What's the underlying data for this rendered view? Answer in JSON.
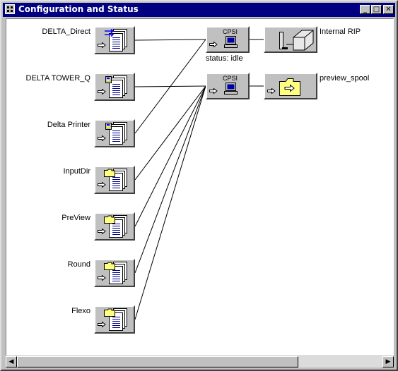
{
  "window": {
    "title": "Configuration and Status",
    "controls": {
      "minimize": "_",
      "maximize": "□",
      "close": "✕"
    }
  },
  "queues": [
    {
      "label": "DELTA_Direct",
      "icon": "direct-queue-icon"
    },
    {
      "label": "DELTA TOWER_Q",
      "icon": "printer-queue-icon"
    },
    {
      "label": "Delta Printer",
      "icon": "printer-queue-icon"
    },
    {
      "label": "InputDir",
      "icon": "folder-queue-icon"
    },
    {
      "label": "PreView",
      "icon": "folder-queue-icon"
    },
    {
      "label": "Round",
      "icon": "folder-queue-icon"
    },
    {
      "label": "Flexo",
      "icon": "folder-queue-icon"
    }
  ],
  "processors": [
    {
      "label": "CPSI",
      "status": "status: idle"
    },
    {
      "label": "CPSI",
      "status": ""
    }
  ],
  "outputs": [
    {
      "label": "Internal RIP",
      "icon": "imagesetter-icon"
    },
    {
      "label": "preview_spool",
      "icon": "spool-folder-icon"
    }
  ],
  "colors": {
    "titlebar": "#000080",
    "face": "#c0c0c0",
    "folder": "#ffff80"
  }
}
